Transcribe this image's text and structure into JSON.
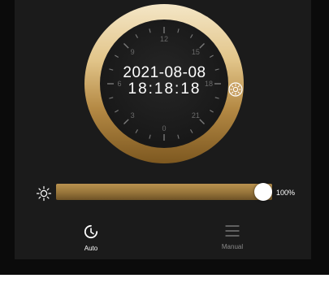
{
  "clock": {
    "date": "2021-08-08",
    "time": "18:18:18",
    "hour_labels": [
      "12",
      "15",
      "18",
      "21",
      "0",
      "3",
      "6",
      "9"
    ],
    "sun_marker_icon": "sun-icon"
  },
  "brightness": {
    "value_percent": 100,
    "value_label": "100%",
    "icon": "sun-icon"
  },
  "modes": {
    "auto": {
      "label": "Auto",
      "icon": "clock-icon",
      "active": true
    },
    "manual": {
      "label": "Manual",
      "icon": "menu-lines-icon",
      "active": false
    }
  },
  "colors": {
    "gold_light": "#f3e2bd",
    "gold_dark": "#8a6424",
    "face": "#1c1c1c",
    "tick": "#7a7a7a"
  }
}
